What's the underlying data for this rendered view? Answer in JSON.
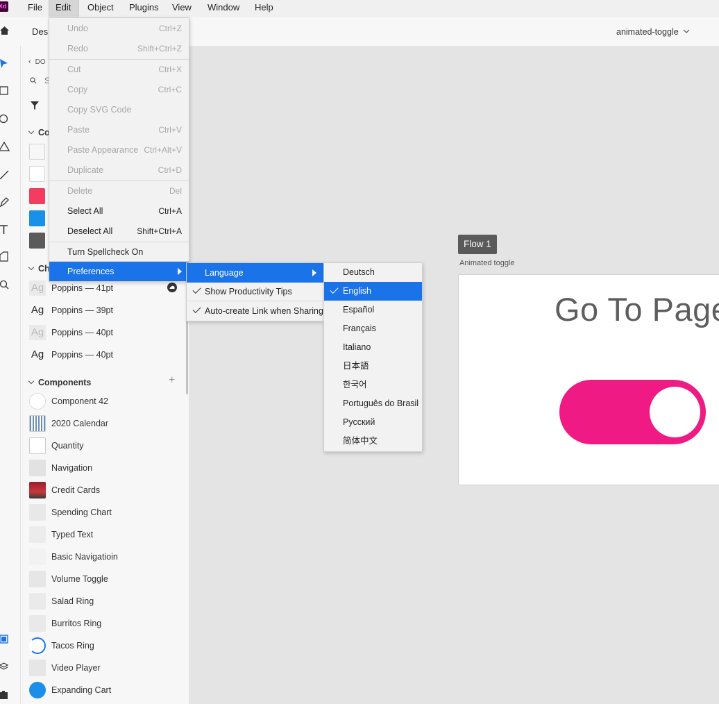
{
  "menubar": {
    "app_logo": "Xd",
    "items": [
      "File",
      "Edit",
      "Object",
      "Plugins",
      "View",
      "Window",
      "Help"
    ],
    "active": "Edit"
  },
  "header": {
    "tab_design": "Desi",
    "document_name": "animated-toggle"
  },
  "panel": {
    "back_label": "DO",
    "search_partial": "S",
    "colors_head": "Co",
    "swatches": [
      "#f7f7f7",
      "#ffffff",
      "#f23d61",
      "#1a91e8",
      "#5a5a5a"
    ],
    "char_head": "Ch",
    "char_styles": [
      {
        "glyph": "Ag",
        "label": "Poppins — 41pt",
        "dim": true
      },
      {
        "glyph": "Ag",
        "label": "Poppins — 39pt",
        "dim": false
      },
      {
        "glyph": "Ag",
        "label": "Poppins — 40pt",
        "dim": true
      },
      {
        "glyph": "Ag",
        "label": "Poppins — 40pt",
        "dim": false
      }
    ],
    "components_head": "Components",
    "components_add": "+",
    "components": [
      "Component 42",
      "2020 Calendar",
      "Quantity",
      "Navigation",
      "Credit Cards",
      "Spending Chart",
      "Typed Text",
      "Basic Navigatioin",
      "Volume Toggle",
      "Salad Ring",
      "Burritos Ring",
      "Tacos Ring",
      "Video Player",
      "Expanding Cart"
    ]
  },
  "edit_menu": {
    "items": [
      {
        "label": "Undo",
        "shortcut": "Ctrl+Z",
        "disabled": true
      },
      {
        "label": "Redo",
        "shortcut": "Shift+Ctrl+Z",
        "disabled": true
      },
      {
        "label": "Cut",
        "shortcut": "Ctrl+X",
        "disabled": true
      },
      {
        "label": "Copy",
        "shortcut": "Ctrl+C",
        "disabled": true
      },
      {
        "label": "Copy SVG Code",
        "shortcut": "",
        "disabled": true
      },
      {
        "label": "Paste",
        "shortcut": "Ctrl+V",
        "disabled": true
      },
      {
        "label": "Paste Appearance",
        "shortcut": "Ctrl+Alt+V",
        "disabled": true
      },
      {
        "label": "Duplicate",
        "shortcut": "Ctrl+D",
        "disabled": true
      },
      {
        "label": "Delete",
        "shortcut": "Del",
        "disabled": true
      },
      {
        "label": "Select All",
        "shortcut": "Ctrl+A",
        "disabled": false
      },
      {
        "label": "Deselect All",
        "shortcut": "Shift+Ctrl+A",
        "disabled": false
      },
      {
        "label": "Turn Spellcheck On",
        "shortcut": "",
        "disabled": false
      },
      {
        "label": "Preferences",
        "shortcut": "",
        "disabled": false,
        "highlighted": true,
        "submenu": true
      }
    ]
  },
  "prefs_menu": {
    "items": [
      {
        "label": "Language",
        "highlighted": true,
        "submenu": true,
        "checked": false
      },
      {
        "label": "Show Productivity Tips",
        "checked": true
      },
      {
        "label": "Auto-create Link when Sharing",
        "checked": true
      }
    ]
  },
  "language_menu": {
    "items": [
      "Deutsch",
      "English",
      "Español",
      "Français",
      "Italiano",
      "日本語",
      "한국어",
      "Português do Brasil",
      "Русский",
      "简体中文"
    ],
    "selected": "English"
  },
  "canvas": {
    "flow_label": "Flow 1",
    "artboard_label": "Animated toggle",
    "headline": "Go To Page",
    "toggle_color": "#ef1a84",
    "toggle_state": "on"
  }
}
